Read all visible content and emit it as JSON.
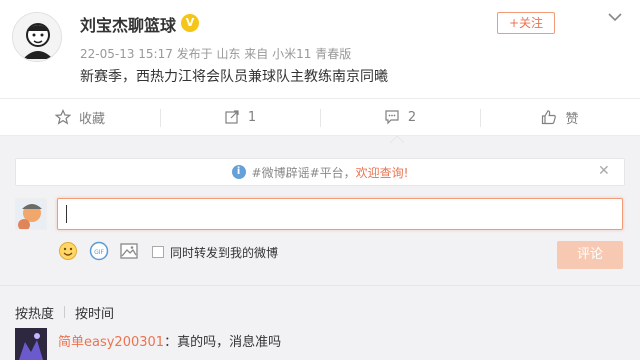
{
  "post": {
    "author": "刘宝杰聊篮球",
    "verified_badge": "V",
    "meta": "22-05-13 15:17 发布于 山东 来自 小米11 青春版",
    "text": "新赛季，西热力江将会队员兼球队主教练南京同曦",
    "follow_label": "+关注"
  },
  "actions": {
    "favorite": "收藏",
    "repost": "1",
    "comment": "2",
    "like": "赞"
  },
  "comment_box": {
    "notice_prefix": "#微博辟谣#平台，",
    "notice_highlight": "欢迎查询!",
    "repost_checkbox_label": "同时转发到我的微博",
    "submit_label": "评论"
  },
  "sort": {
    "hot": "按热度",
    "time": "按时间"
  },
  "comments": [
    {
      "user": "简单easy200301",
      "text": "：真的吗，消息准吗"
    }
  ],
  "colors": {
    "accent": "#eb7350",
    "submit_disabled": "#f7c9b2",
    "info_blue": "#65a0d8",
    "verified_gold": "#f5c518"
  },
  "icons": [
    "more-icon",
    "favorite-icon",
    "repost-icon",
    "comment-icon",
    "like-icon",
    "info-icon",
    "close-icon",
    "emoji-icon",
    "gif-icon",
    "image-icon"
  ]
}
